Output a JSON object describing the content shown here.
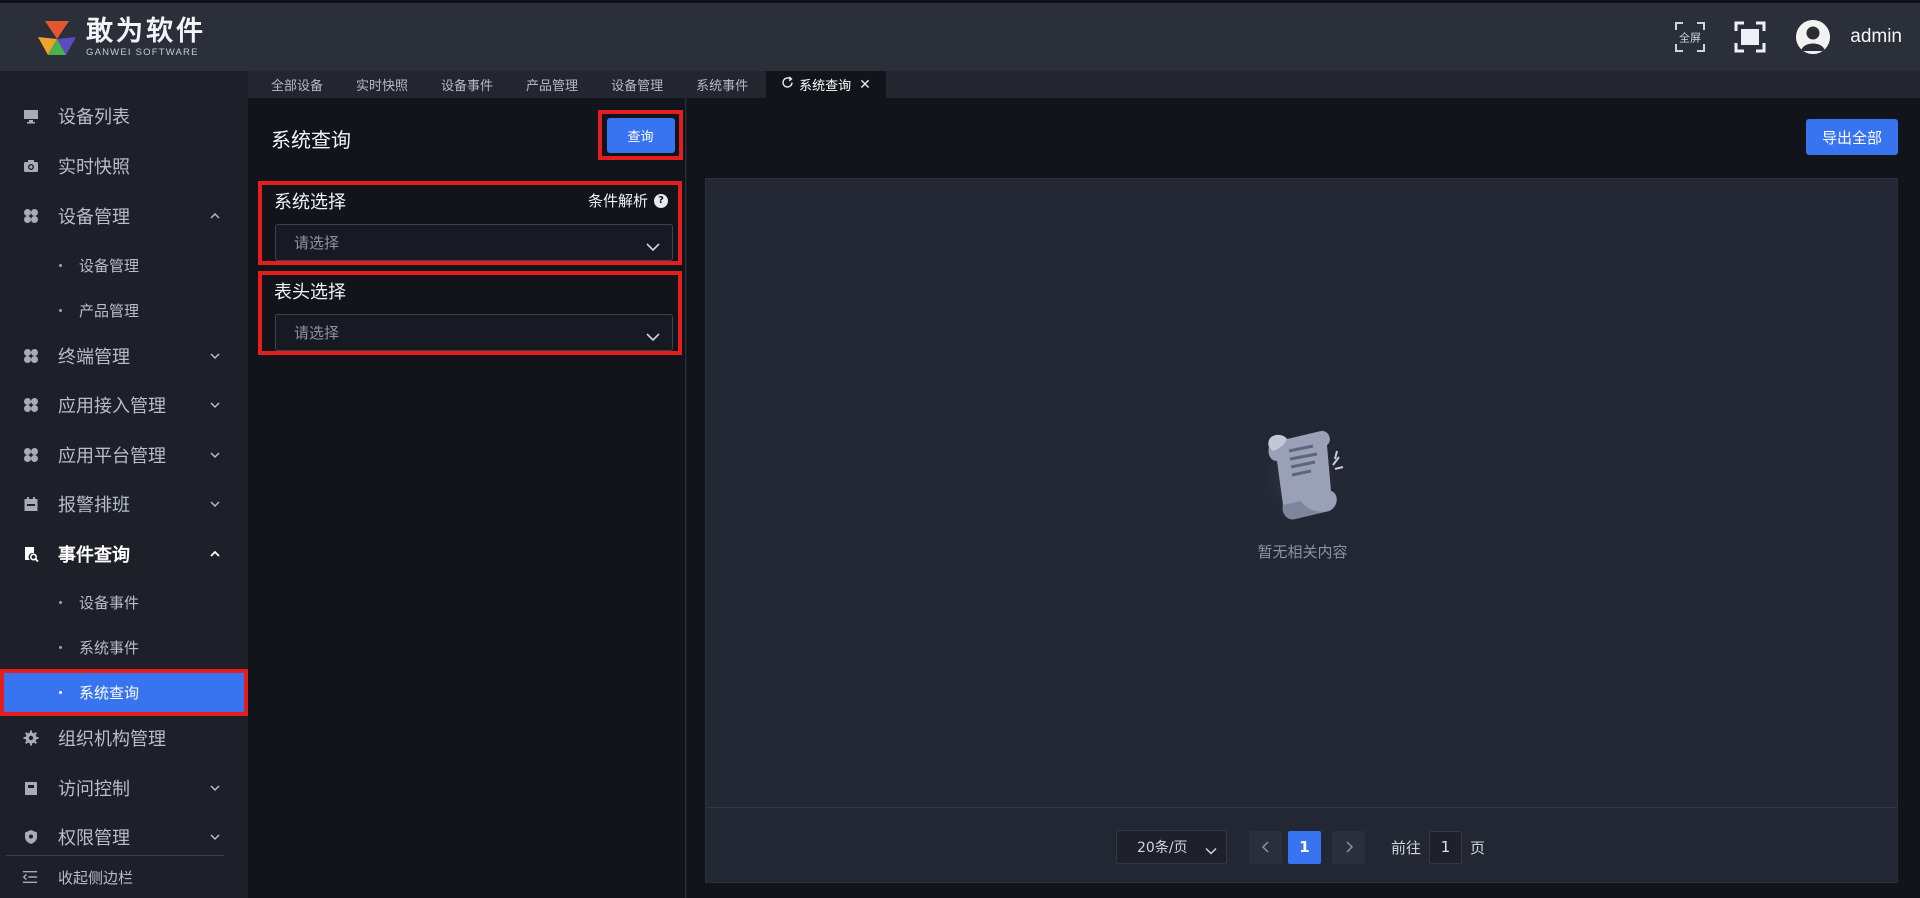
{
  "header": {
    "brand_name": "敢为软件",
    "brand_sub": "GANWEI SOFTWARE",
    "fullscreen_label": "全屏",
    "username": "admin"
  },
  "sidebar": {
    "items": [
      {
        "label": "设备列表",
        "icon": "monitor-icon"
      },
      {
        "label": "实时快照",
        "icon": "camera-icon"
      },
      {
        "label": "设备管理",
        "icon": "grid-icon",
        "expanded": true
      },
      {
        "label": "终端管理",
        "icon": "grid-icon"
      },
      {
        "label": "应用接入管理",
        "icon": "grid-icon"
      },
      {
        "label": "应用平台管理",
        "icon": "grid-icon"
      },
      {
        "label": "报警排班",
        "icon": "calendar-icon"
      },
      {
        "label": "事件查询",
        "icon": "search-doc-icon",
        "expanded": true
      },
      {
        "label": "组织机构管理",
        "icon": "gear-icon"
      },
      {
        "label": "访问控制",
        "icon": "lock-icon"
      },
      {
        "label": "权限管理",
        "icon": "shield-icon"
      }
    ],
    "device_sub": [
      "设备管理",
      "产品管理"
    ],
    "event_sub": [
      "设备事件",
      "系统事件",
      "系统查询"
    ],
    "collapse_label": "收起侧边栏"
  },
  "tabs": [
    "全部设备",
    "实时快照",
    "设备事件",
    "产品管理",
    "设备管理",
    "系统事件",
    "系统查询"
  ],
  "query": {
    "title": "系统查询",
    "query_button": "查询",
    "system_select_title": "系统选择",
    "condition_hint": "条件解析",
    "system_placeholder": "请选择",
    "header_select_title": "表头选择",
    "header_placeholder": "请选择"
  },
  "result": {
    "export_button": "导出全部",
    "empty_text": "暂无相关内容"
  },
  "pagination": {
    "page_size": "20条/页",
    "current_page": "1",
    "goto_label": "前往",
    "goto_value": "1",
    "page_unit": "页"
  },
  "colors": {
    "primary": "#3873f0",
    "highlight_border": "#e41d1d",
    "header_bg": "#2b2f3a",
    "sidebar_bg": "#1d2029"
  }
}
